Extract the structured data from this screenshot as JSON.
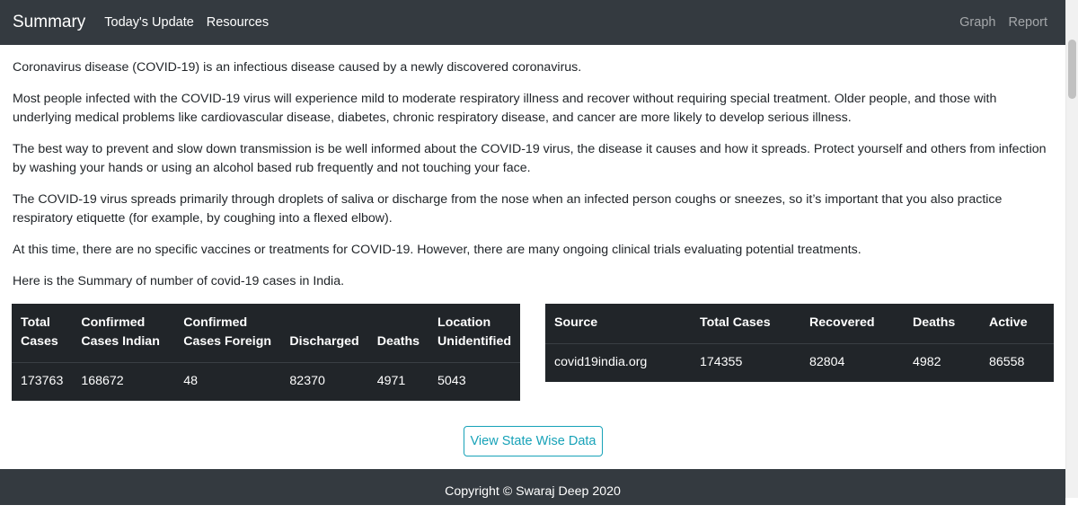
{
  "navbar": {
    "brand": "Summary",
    "links": [
      "Today's Update",
      "Resources"
    ],
    "right_links": [
      "Graph",
      "Report"
    ]
  },
  "paragraphs": [
    "Coronavirus disease (COVID-19) is an infectious disease caused by a newly discovered coronavirus.",
    "Most people infected with the COVID-19 virus will experience mild to moderate respiratory illness and recover without requiring special treatment. Older people, and those with underlying medical problems like cardiovascular disease, diabetes, chronic respiratory disease, and cancer are more likely to develop serious illness.",
    "The best way to prevent and slow down transmission is be well informed about the COVID-19 virus, the disease it causes and how it spreads. Protect yourself and others from infection by washing your hands or using an alcohol based rub frequently and not touching your face.",
    "The COVID-19 virus spreads primarily through droplets of saliva or discharge from the nose when an infected person coughs or sneezes, so it’s important that you also practice respiratory etiquette (for example, by coughing into a flexed elbow).",
    "At this time, there are no specific vaccines or treatments for COVID-19. However, there are many ongoing clinical trials evaluating potential treatments.",
    "Here is the Summary of number of covid-19 cases in India."
  ],
  "table1": {
    "headers": [
      "Total Cases",
      "Confirmed Cases Indian",
      "Confirmed Cases Foreign",
      "Discharged",
      "Deaths",
      "Location Unidentified"
    ],
    "rows": [
      [
        "173763",
        "168672",
        "48",
        "82370",
        "4971",
        "5043"
      ]
    ]
  },
  "table2": {
    "headers": [
      "Source",
      "Total Cases",
      "Recovered",
      "Deaths",
      "Active"
    ],
    "rows": [
      [
        "covid19india.org",
        "174355",
        "82804",
        "4982",
        "86558"
      ]
    ]
  },
  "button": {
    "label": "View State Wise Data"
  },
  "footer": {
    "text": "Copyright © Swaraj Deep 2020"
  }
}
